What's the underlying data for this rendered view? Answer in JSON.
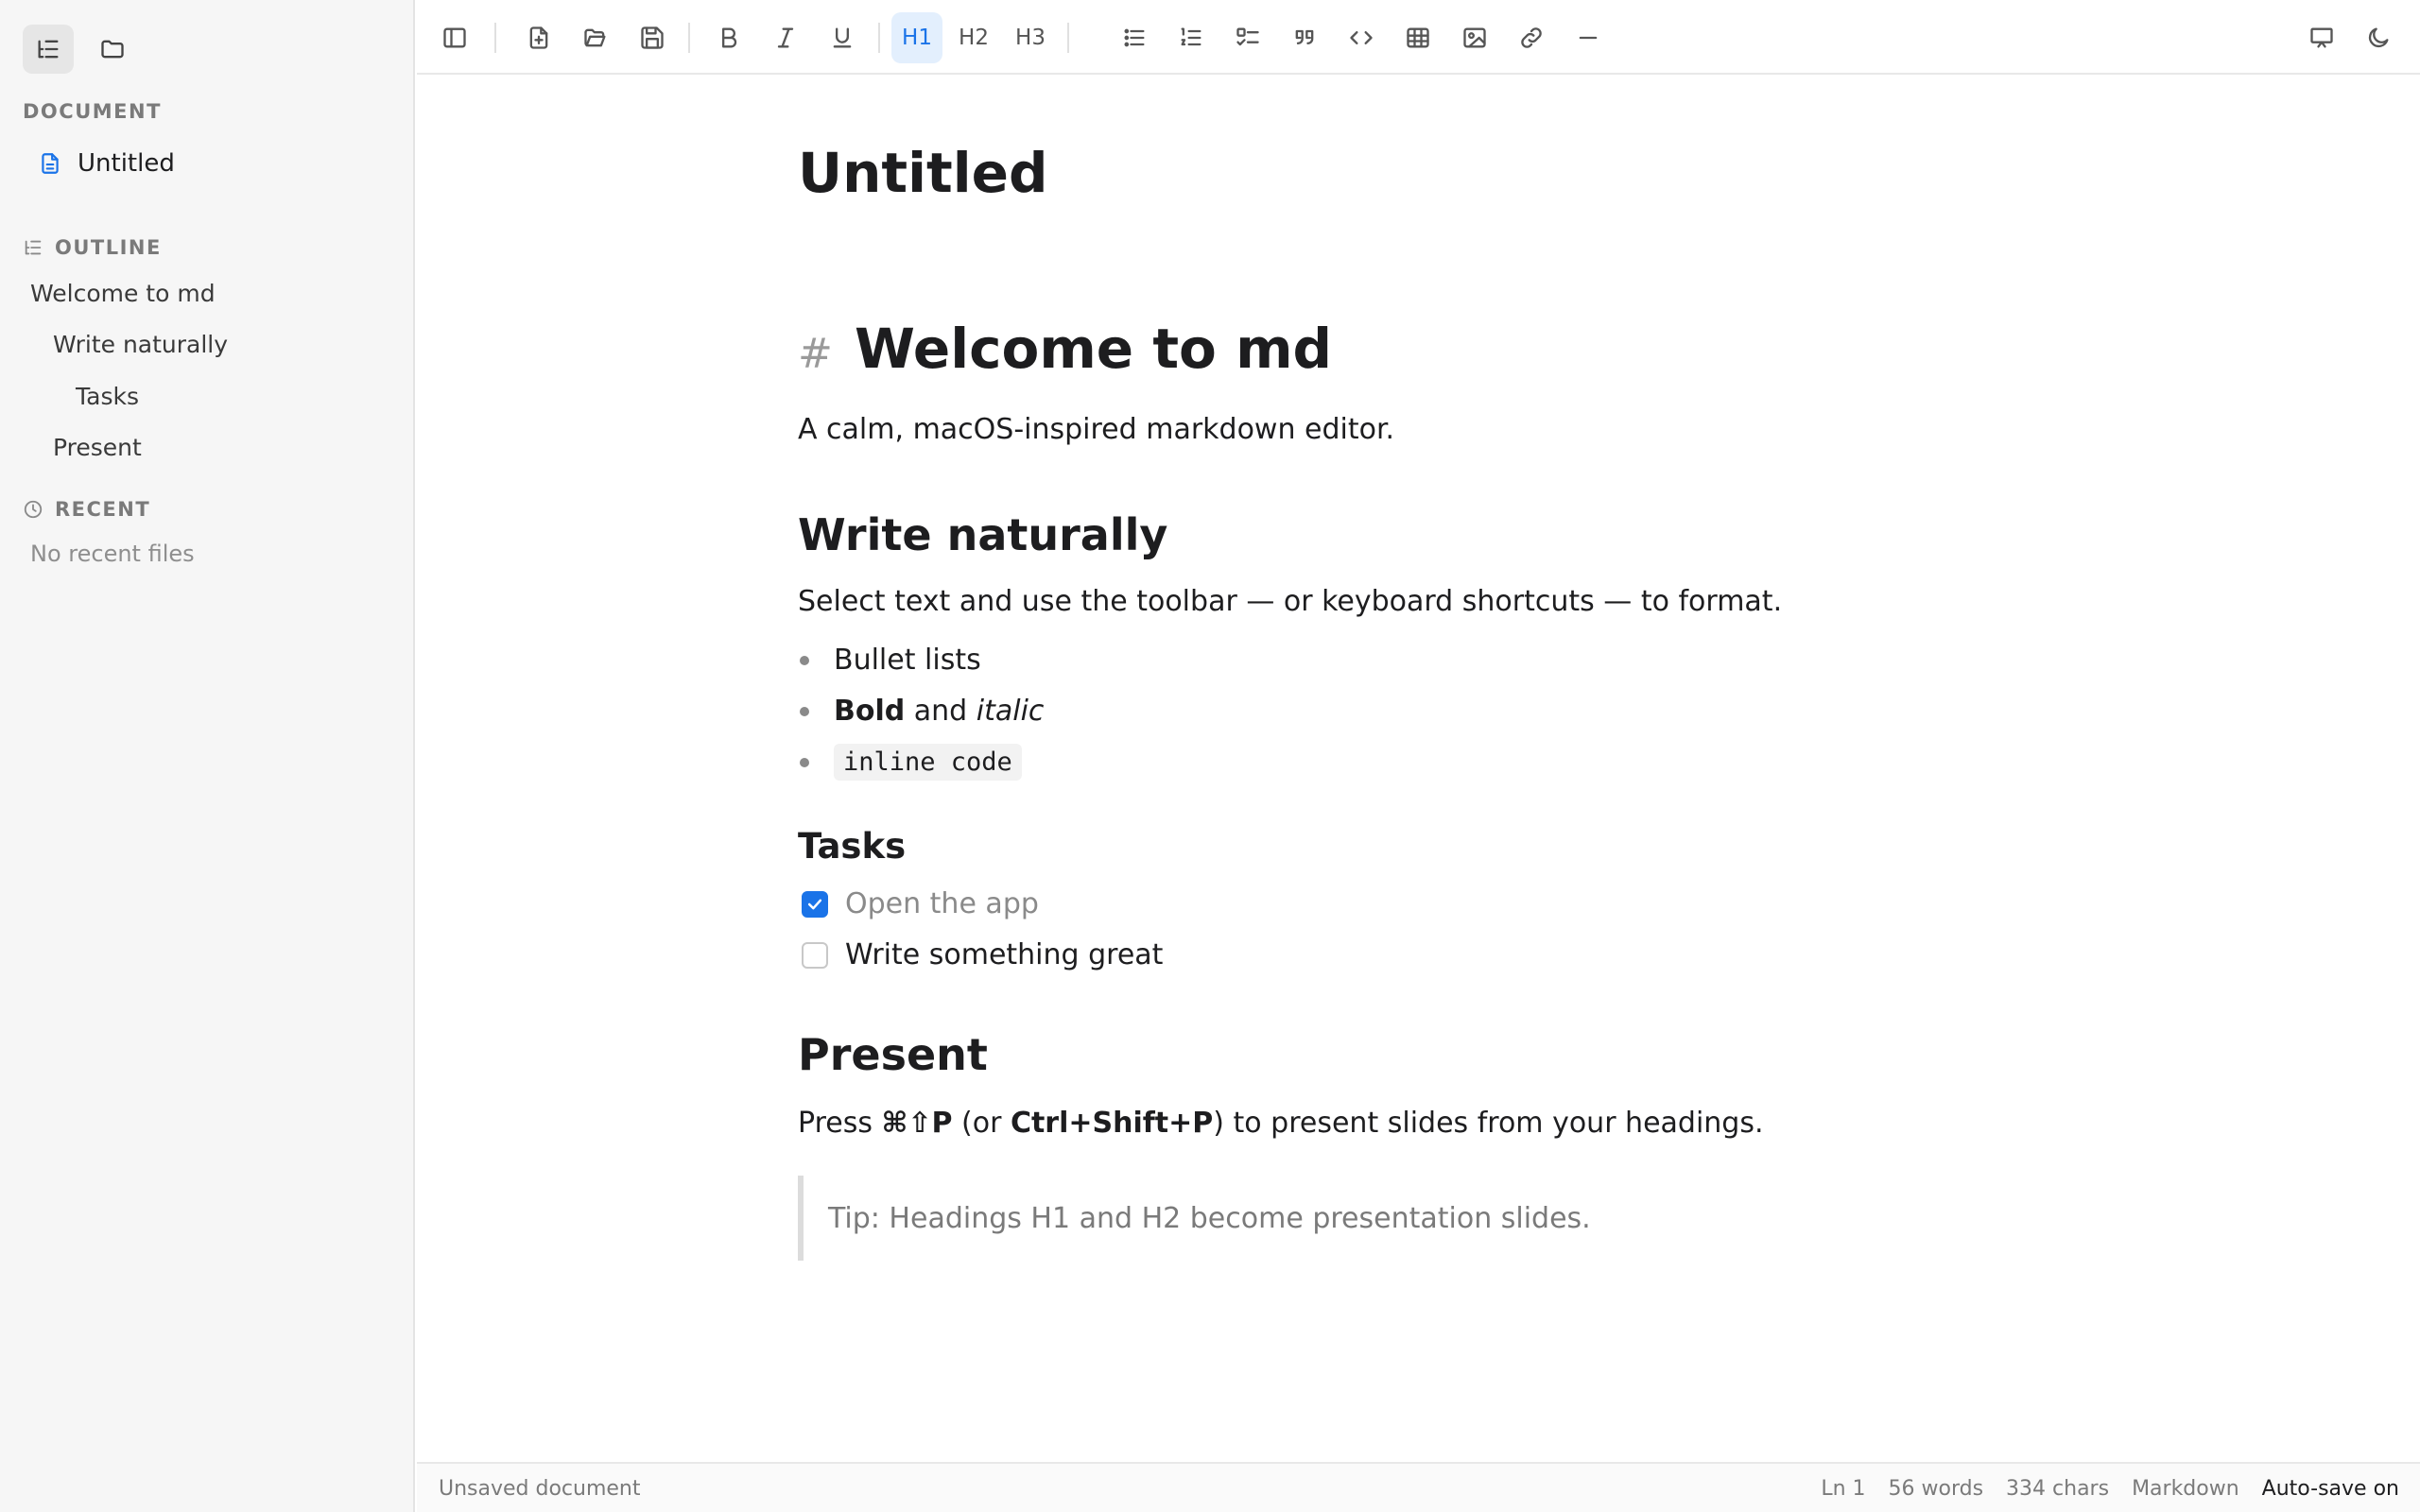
{
  "sidebar": {
    "document_heading": "DOCUMENT",
    "document_name": "Untitled",
    "outline_heading": "OUTLINE",
    "outline": [
      {
        "label": "Welcome to md",
        "level": 1
      },
      {
        "label": "Write naturally",
        "level": 2
      },
      {
        "label": "Tasks",
        "level": 3
      },
      {
        "label": "Present",
        "level": 2
      }
    ],
    "recent_heading": "RECENT",
    "recent_empty": "No recent files"
  },
  "toolbar": {
    "h1_label": "H1",
    "h2_label": "H2",
    "h3_label": "H3"
  },
  "editor": {
    "doc_title": "Untitled",
    "h1_marker": "#",
    "h1": "Welcome to md",
    "intro": "A calm, macOS-inspired markdown editor.",
    "h2_write": "Write naturally",
    "write_para": "Select text and use the toolbar — or keyboard shortcuts — to format.",
    "bullets": {
      "first": "Bullet lists",
      "bold": "Bold",
      "and": " and ",
      "italic": "italic",
      "code": "inline code"
    },
    "h3_tasks": "Tasks",
    "tasks": [
      {
        "label": "Open the app",
        "checked": true
      },
      {
        "label": "Write something great",
        "checked": false
      }
    ],
    "h2_present": "Present",
    "present_para": {
      "press": "Press ",
      "shortcut_mac": "⌘⇧P",
      "or": " (or ",
      "shortcut_pc": "Ctrl+Shift+P",
      "rest": ") to present slides from your headings."
    },
    "tip": "Tip: Headings H1 and H2 become presentation slides."
  },
  "status": {
    "left": "Unsaved document",
    "line": "Ln 1",
    "words": "56 words",
    "chars": "334 chars",
    "mode": "Markdown",
    "autosave": "Auto-save on"
  },
  "colors": {
    "accent": "#1a73e8",
    "sidebar_bg": "#f6f6f6"
  }
}
